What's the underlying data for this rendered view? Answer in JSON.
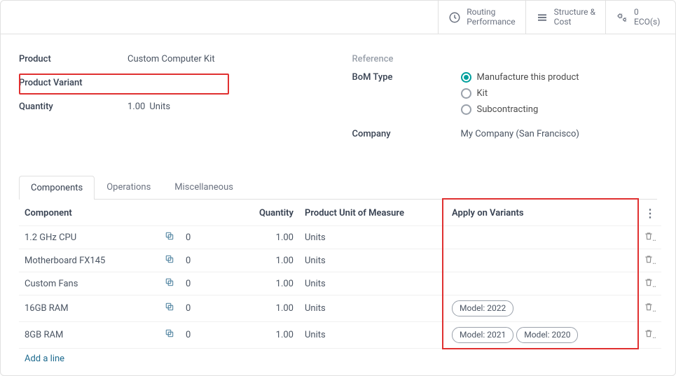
{
  "topbar": {
    "routing": {
      "line1": "Routing",
      "line2": "Performance"
    },
    "structure": {
      "line1": "Structure &",
      "line2": "Cost"
    },
    "eco": {
      "line1": "0",
      "line2": "ECO(s)"
    }
  },
  "form": {
    "left": {
      "product_label": "Product",
      "product_value": "Custom Computer Kit",
      "variant_label": "Product Variant",
      "variant_value": "",
      "quantity_label": "Quantity",
      "quantity_value": "1.00",
      "quantity_unit": "Units"
    },
    "right": {
      "reference_label": "Reference",
      "bom_type_label": "BoM Type",
      "bom_opts": {
        "manufacture": "Manufacture this product",
        "kit": "Kit",
        "subcontract": "Subcontracting"
      },
      "company_label": "Company",
      "company_value": "My Company (San Francisco)"
    }
  },
  "tabs": {
    "components": "Components",
    "operations": "Operations",
    "misc": "Miscellaneous"
  },
  "table": {
    "headers": {
      "component": "Component",
      "quantity": "Quantity",
      "uom": "Product Unit of Measure",
      "variants": "Apply on Variants"
    },
    "rows": [
      {
        "name": "1.2 GHz CPU",
        "extra": "0",
        "qty": "1.00",
        "uom": "Units",
        "variants": []
      },
      {
        "name": "Motherboard FX145",
        "extra": "0",
        "qty": "1.00",
        "uom": "Units",
        "variants": []
      },
      {
        "name": "Custom Fans",
        "extra": "0",
        "qty": "1.00",
        "uom": "Units",
        "variants": []
      },
      {
        "name": "16GB RAM",
        "extra": "0",
        "qty": "1.00",
        "uom": "Units",
        "variants": [
          "Model: 2022"
        ]
      },
      {
        "name": "8GB RAM",
        "extra": "0",
        "qty": "1.00",
        "uom": "Units",
        "variants": [
          "Model: 2021",
          "Model: 2020"
        ]
      }
    ],
    "add_line": "Add a line"
  }
}
